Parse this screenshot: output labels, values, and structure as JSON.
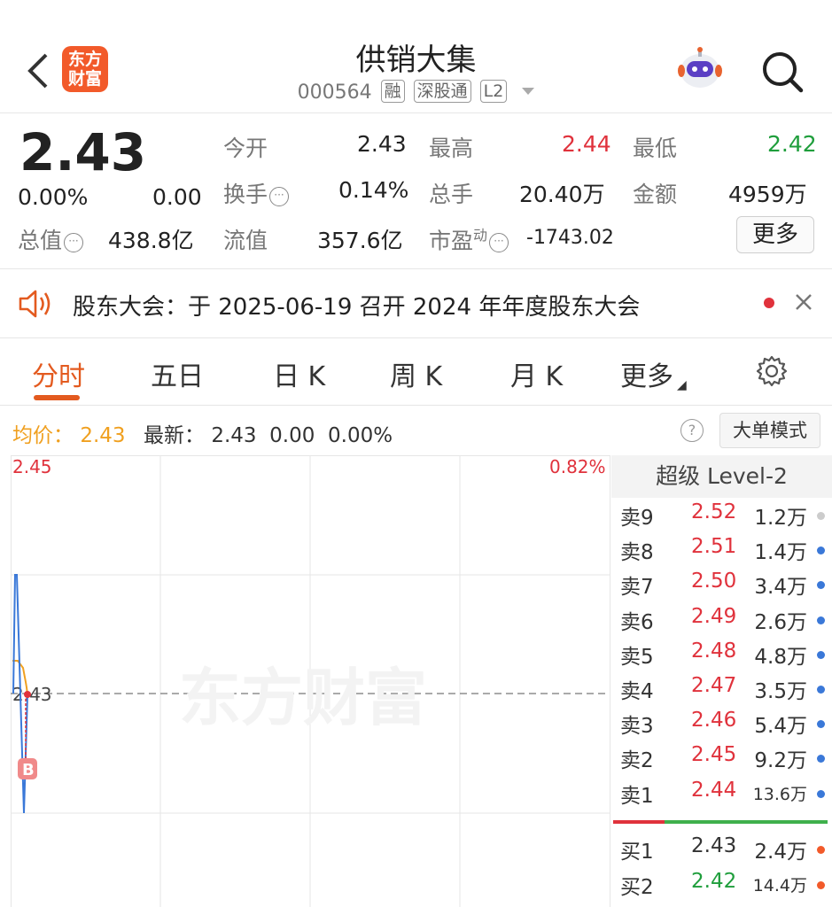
{
  "header": {
    "back": "<",
    "logo_line1": "东方",
    "logo_line2": "财富",
    "title": "供销大集",
    "code": "000564",
    "tags": [
      "融",
      "深股通",
      "L2"
    ]
  },
  "quote": {
    "price": "2.43",
    "change_pct": "0.00%",
    "change": "0.00",
    "open_label": "今开",
    "open": "2.43",
    "high_label": "最高",
    "high": "2.44",
    "low_label": "最低",
    "low": "2.42",
    "turnover_label": "换手",
    "turnover": "0.14%",
    "volume_label": "总手",
    "volume": "20.40万",
    "amount_label": "金额",
    "amount": "4959万",
    "mktcap_label": "总值",
    "mktcap": "438.8亿",
    "float_label": "流值",
    "float": "357.6亿",
    "pe_label": "市盈",
    "pe_sup": "动",
    "pe": "-1743.02",
    "more_button": "更多",
    "colors": {
      "up": "#e0323c",
      "down": "#1f9e3c"
    }
  },
  "notice": {
    "text": "股东大会：于 2025-06-19 召开 2024 年年度股东大会"
  },
  "tabs": [
    "分时",
    "五日",
    "日 K",
    "周 K",
    "月 K",
    "更多"
  ],
  "active_tab": "分时",
  "avg_row": {
    "avg_label": "均价：",
    "avg_value": "2.43",
    "latest_label": "最新：",
    "latest_price": "2.43",
    "latest_change": "0.00",
    "latest_pct": "0.00%",
    "help": "?",
    "big_order_button": "大单模式"
  },
  "chart_data": {
    "type": "line",
    "top_price_label": "2.45",
    "top_pct_label": "0.82%",
    "ref_price_label": "2.43",
    "watermark": "东方财富",
    "buy_marker": "B",
    "ylim": [
      2.41,
      2.45
    ],
    "ref": 2.43,
    "series": [
      {
        "values": [
          2.43,
          2.44,
          2.44,
          2.43,
          2.42,
          2.43
        ],
        "color": "#3a78d8"
      },
      {
        "values": [
          2.435,
          2.435,
          2.432,
          2.431,
          2.43,
          2.43
        ],
        "color": "#f0a020"
      }
    ]
  },
  "level2": {
    "title": "超级 Level-2",
    "asks": [
      {
        "label": "卖9",
        "price": "2.52",
        "vol": "1.2万",
        "dot": "#cccccc"
      },
      {
        "label": "卖8",
        "price": "2.51",
        "vol": "1.4万",
        "dot": "#3a78d8"
      },
      {
        "label": "卖7",
        "price": "2.50",
        "vol": "3.4万",
        "dot": "#3a78d8"
      },
      {
        "label": "卖6",
        "price": "2.49",
        "vol": "2.6万",
        "dot": "#3a78d8"
      },
      {
        "label": "卖5",
        "price": "2.48",
        "vol": "4.8万",
        "dot": "#3a78d8"
      },
      {
        "label": "卖4",
        "price": "2.47",
        "vol": "3.5万",
        "dot": "#3a78d8"
      },
      {
        "label": "卖3",
        "price": "2.46",
        "vol": "5.4万",
        "dot": "#3a78d8"
      },
      {
        "label": "卖2",
        "price": "2.45",
        "vol": "9.2万",
        "dot": "#3a78d8"
      },
      {
        "label": "卖1",
        "price": "2.44",
        "vol": "13.6万",
        "dot": "#3a78d8"
      }
    ],
    "bids": [
      {
        "label": "买1",
        "price": "2.43",
        "vol": "2.4万",
        "dot": "#f25a2a",
        "color": "#333333"
      },
      {
        "label": "买2",
        "price": "2.42",
        "vol": "14.4万",
        "dot": "#f25a2a",
        "color": "#1f9e3c"
      }
    ]
  }
}
